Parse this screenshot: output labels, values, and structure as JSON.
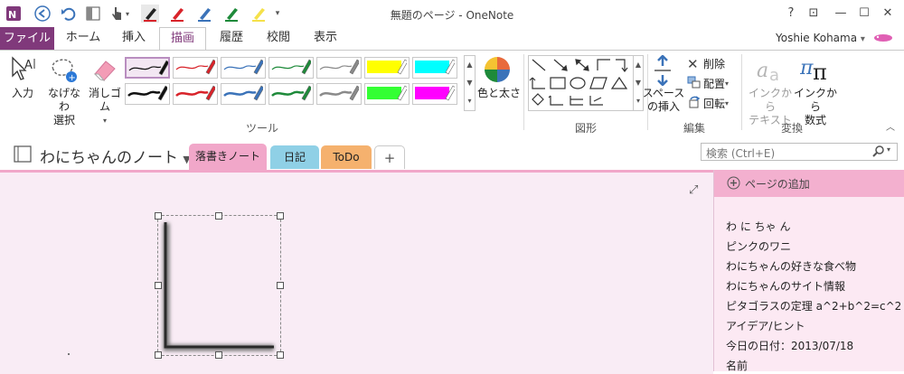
{
  "window": {
    "title": "無題のページ - OneNote",
    "help": "?",
    "min": "—",
    "restore": "☐",
    "close": "✕",
    "ribbon_display": "⊡"
  },
  "ribbon_tabs": [
    "ファイル",
    "ホーム",
    "挿入",
    "描画",
    "履歴",
    "校閲",
    "表示"
  ],
  "user": {
    "name": "Yoshie Kohama",
    "dropdown": "▾"
  },
  "tools": {
    "type": "入力",
    "lasso": [
      "なげなわ",
      "選択"
    ],
    "eraser": "消しゴム",
    "color_thickness": "色と太さ",
    "group_label": "ツール"
  },
  "pens": {
    "row1": [
      {
        "stroke": "#111111",
        "selected": true
      },
      {
        "stroke": "#d8232a"
      },
      {
        "stroke": "#3b73b9"
      },
      {
        "stroke": "#1e8a3a"
      },
      {
        "stroke": "#8a8a8a"
      },
      {
        "stroke": "#ffff00",
        "highlighter": true
      },
      {
        "stroke": "#00ffff",
        "highlighter": true
      }
    ],
    "row2": [
      {
        "stroke": "#111111"
      },
      {
        "stroke": "#d8232a"
      },
      {
        "stroke": "#3b73b9"
      },
      {
        "stroke": "#1e8a3a"
      },
      {
        "stroke": "#8a8a8a"
      },
      {
        "stroke": "#33ff33",
        "highlighter": true
      },
      {
        "stroke": "#ff00ff",
        "highlighter": true
      }
    ]
  },
  "shapes": {
    "group_label": "図形"
  },
  "edit": {
    "space": [
      "スペース",
      "の挿入"
    ],
    "delete": "削除",
    "arrange": "配置",
    "rotate": "回転",
    "group_label": "編集"
  },
  "convert": {
    "ink_to_text": [
      "インクから",
      "テキスト"
    ],
    "ink_to_math": [
      "インクから",
      "数式"
    ],
    "group_label": "変換"
  },
  "notebook": {
    "name": "わにちゃんのノート",
    "tabs": [
      {
        "label": "落書きノート",
        "color": "#f1a7c9"
      },
      {
        "label": "日記",
        "color": "#8fd0e6"
      },
      {
        "label": "ToDo",
        "color": "#f5b16e"
      },
      {
        "label": "+",
        "color": "#ffffff"
      }
    ]
  },
  "search": {
    "placeholder": "検索 (Ctrl+E)"
  },
  "pages_panel": {
    "add_page": "ページの追加",
    "pages": [
      "わ に ちゃ ん",
      "ピンクのワニ",
      "わにちゃんの好きな食べ物",
      "わにちゃんのサイト情報",
      "ピタゴラスの定理  a^2+b^2=c^2",
      "アイデア/ヒント",
      "今日の日付：2013/07/18",
      "名前"
    ]
  },
  "colors": {
    "accent": "#80397b",
    "section": "#f1a7c9",
    "page_bg": "#f9ecf5"
  }
}
